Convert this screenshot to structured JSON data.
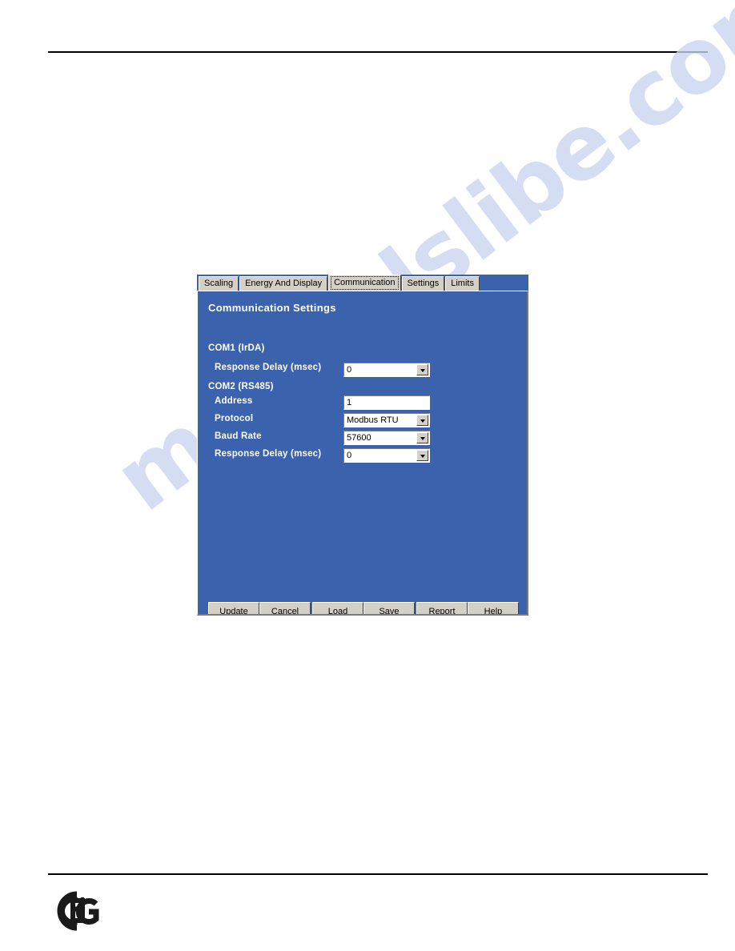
{
  "page": {
    "watermark_text": "manualslibe.com",
    "rule_color": "#000000"
  },
  "dialog": {
    "panel_color": "#3b62ad",
    "chrome_color": "#d4d0c8",
    "tabs": [
      {
        "label": "Scaling",
        "active": false
      },
      {
        "label": "Energy And Display",
        "active": false
      },
      {
        "label": "Communication",
        "active": true
      },
      {
        "label": "Settings",
        "active": false
      },
      {
        "label": "Limits",
        "active": false
      }
    ],
    "title": "Communication Settings",
    "groups": [
      {
        "label": "COM1 (IrDA)"
      },
      {
        "label": "COM2 (RS485)"
      }
    ],
    "fields": [
      {
        "label": "Response Delay (msec)",
        "value": "0",
        "type": "combobox",
        "group": "COM1 (IrDA)"
      },
      {
        "label": "Address",
        "value": "1",
        "type": "textbox",
        "group": "COM2 (RS485)"
      },
      {
        "label": "Protocol",
        "value": "Modbus RTU",
        "type": "combobox",
        "group": "COM2 (RS485)"
      },
      {
        "label": "Baud Rate",
        "value": "57600",
        "type": "combobox",
        "group": "COM2 (RS485)"
      },
      {
        "label": "Response Delay (msec)",
        "value": "0",
        "type": "combobox",
        "group": "COM2 (RS485)"
      }
    ],
    "buttons": [
      {
        "label": "Update",
        "accel": "U",
        "group": 1
      },
      {
        "label": "Cancel",
        "accel": "C",
        "group": 1
      },
      {
        "label": "Load",
        "accel": "L",
        "group": 2
      },
      {
        "label": "Save",
        "accel": "S",
        "group": 2
      },
      {
        "label": "Report",
        "accel": "R",
        "group": 3
      },
      {
        "label": "Help",
        "accel": "H",
        "group": 3
      }
    ]
  },
  "footer": {
    "logo_name": "eig-logo",
    "logo_text": "EIG"
  }
}
